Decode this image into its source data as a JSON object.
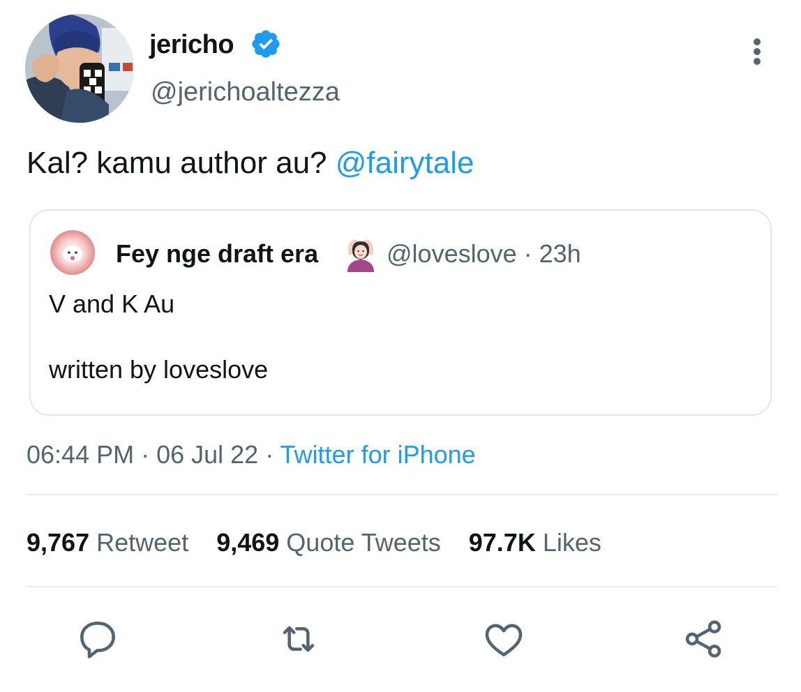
{
  "author": {
    "display_name": "jericho",
    "verified_icon": "verified-badge-icon",
    "handle": "@jerichoaltezza"
  },
  "tweet": {
    "text": "Kal? kamu author au? ",
    "mention": "@fairytale"
  },
  "quoted_tweet": {
    "display_name": "Fey nge draft era",
    "emoji_icon": "person-gesturing-ok-emoji",
    "handle_time": "@loveslove · 23h",
    "line1": "V and K Au",
    "line2": "written by loveslove"
  },
  "meta": {
    "time": "06:44 PM",
    "separator": " · ",
    "date": "06 Jul 22",
    "separator2": " · ",
    "source": "Twitter for iPhone"
  },
  "stats": {
    "retweets_count": "9,767",
    "retweets_label": "Retweet",
    "quotes_count": "9,469",
    "quotes_label": "Quote Tweets",
    "likes_count": "97.7K",
    "likes_label": "Likes"
  },
  "actions": [
    "reply-icon",
    "retweet-icon",
    "like-icon",
    "share-icon"
  ],
  "colors": {
    "accent": "#1d9bf0",
    "secondary_text": "#536471",
    "border": "#e1e8ed"
  }
}
